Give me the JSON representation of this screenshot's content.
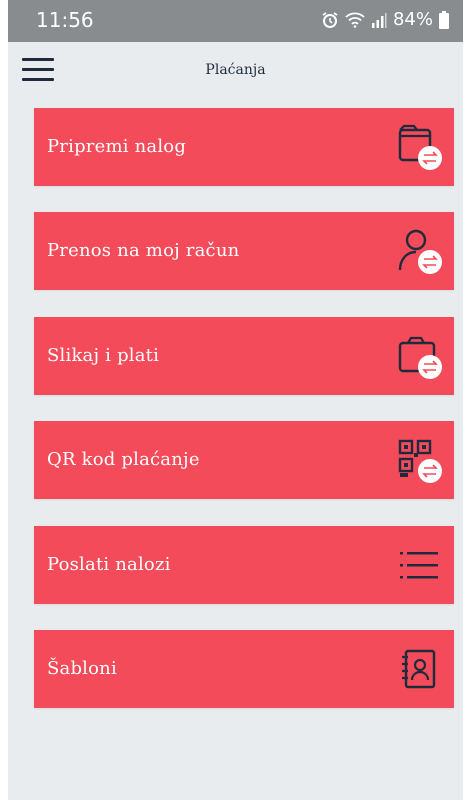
{
  "status_bar": {
    "time": "11:56",
    "battery": "84%",
    "icons": [
      "alarm-icon",
      "wifi-icon",
      "signal-icon",
      "battery-icon"
    ]
  },
  "header": {
    "title": "Plaćanja",
    "menu_icon": "hamburger-menu-icon"
  },
  "colors": {
    "tile_bg": "#f34b5a",
    "screen_bg": "#e9ecef",
    "icon_dark": "#1f2b3d",
    "status_bar": "#888c8e"
  },
  "menu": {
    "items": [
      {
        "label": "Pripremi nalog",
        "icon": "order-form-transfer-icon"
      },
      {
        "label": "Prenos na moj račun",
        "icon": "person-transfer-icon"
      },
      {
        "label": "Slikaj i plati",
        "icon": "camera-transfer-icon"
      },
      {
        "label": "QR kod plaćanje",
        "icon": "qr-code-transfer-icon"
      },
      {
        "label": "Poslati nalozi",
        "icon": "list-icon"
      },
      {
        "label": "Šabloni",
        "icon": "contact-book-icon"
      }
    ]
  }
}
